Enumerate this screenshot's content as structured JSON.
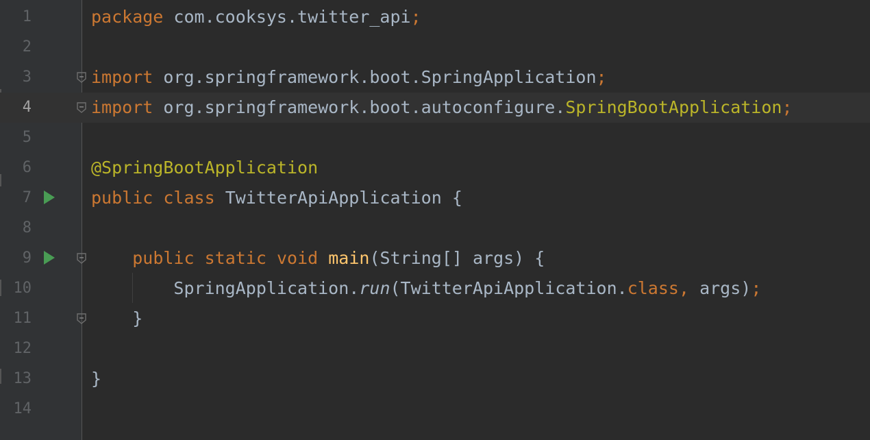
{
  "editor": {
    "lines": [
      {
        "num": "1",
        "tokens": [
          {
            "t": "package",
            "c": "kw"
          },
          {
            "t": " com.cooksys.twitter_api",
            "c": "plain"
          },
          {
            "t": ";",
            "c": "kw"
          }
        ]
      },
      {
        "num": "2",
        "tokens": []
      },
      {
        "num": "3",
        "fold": true,
        "tokens": [
          {
            "t": "import",
            "c": "kw"
          },
          {
            "t": " org.springframework.boot.SpringApplication",
            "c": "plain"
          },
          {
            "t": ";",
            "c": "kw"
          }
        ]
      },
      {
        "num": "4",
        "fold": true,
        "current": true,
        "tokens": [
          {
            "t": "import",
            "c": "kw"
          },
          {
            "t": " org.springframework.boot.autoconfigure.",
            "c": "plain"
          },
          {
            "t": "SpringBootApplication",
            "c": "cls-ref"
          },
          {
            "t": ";",
            "c": "kw"
          }
        ]
      },
      {
        "num": "5",
        "tokens": []
      },
      {
        "num": "6",
        "tokens": [
          {
            "t": "@SpringBootApplication",
            "c": "ann"
          }
        ]
      },
      {
        "num": "7",
        "run": true,
        "tokens": [
          {
            "t": "public",
            "c": "kw"
          },
          {
            "t": " ",
            "c": "plain"
          },
          {
            "t": "class",
            "c": "kw"
          },
          {
            "t": " TwitterApiApplication {",
            "c": "plain"
          }
        ]
      },
      {
        "num": "8",
        "tokens": []
      },
      {
        "num": "9",
        "run": true,
        "fold": true,
        "tokens": [
          {
            "t": "    ",
            "c": "plain"
          },
          {
            "t": "public",
            "c": "kw"
          },
          {
            "t": " ",
            "c": "plain"
          },
          {
            "t": "static",
            "c": "kw"
          },
          {
            "t": " ",
            "c": "plain"
          },
          {
            "t": "void",
            "c": "kw"
          },
          {
            "t": " ",
            "c": "plain"
          },
          {
            "t": "main",
            "c": "fn"
          },
          {
            "t": "(String[] args) {",
            "c": "plain"
          }
        ]
      },
      {
        "num": "10",
        "tokens": [
          {
            "t": "        SpringApplication.",
            "c": "plain"
          },
          {
            "t": "run",
            "c": "it"
          },
          {
            "t": "(TwitterApiApplication.",
            "c": "plain"
          },
          {
            "t": "class",
            "c": "kw"
          },
          {
            "t": ",",
            "c": "kw"
          },
          {
            "t": " args)",
            "c": "plain"
          },
          {
            "t": ";",
            "c": "kw"
          }
        ]
      },
      {
        "num": "11",
        "fold": true,
        "tokens": [
          {
            "t": "    }",
            "c": "plain"
          }
        ]
      },
      {
        "num": "12",
        "tokens": []
      },
      {
        "num": "13",
        "tokens": [
          {
            "t": "}",
            "c": "plain"
          }
        ]
      },
      {
        "num": "14",
        "tokens": []
      }
    ]
  },
  "colors": {
    "background": "#2b2b2b",
    "gutter": "#313335",
    "keyword": "#cc7832",
    "identifier": "#a9b7c6",
    "annotation": "#bbb529",
    "method": "#ffc66d",
    "run_icon": "#499c54"
  },
  "icons": {
    "run": "run-triangle-icon",
    "fold": "fold-marker-icon"
  }
}
